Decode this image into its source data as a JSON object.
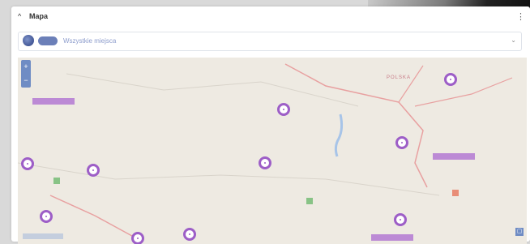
{
  "widget": {
    "title": "Mapa",
    "collapse_icon": "chevron-up-icon",
    "menu_icon": "kebab-icon"
  },
  "layer_selector": {
    "icon": "globe-icon",
    "badge": "",
    "selected": "Wszystkie miejsca"
  },
  "map": {
    "country_label": "POLSKA",
    "marker_color": "#9d5ec7",
    "zoom_in": "+",
    "zoom_out": "−",
    "fullscreen_icon": "fullscreen-icon"
  }
}
